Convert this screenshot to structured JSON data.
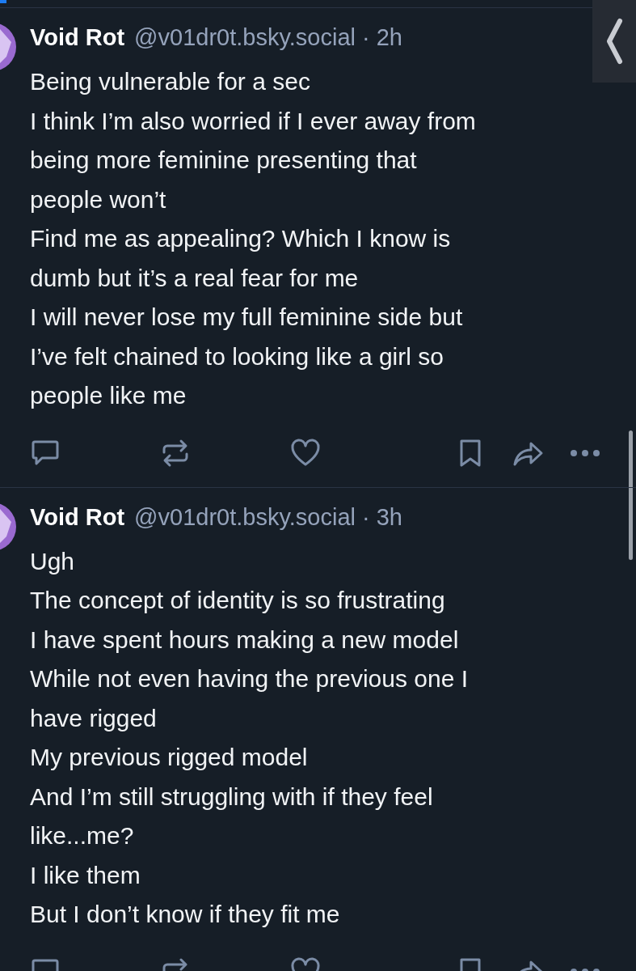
{
  "posts": [
    {
      "name": "Void Rot",
      "handle": "@v01dr0t.bsky.social",
      "separator": "·",
      "time": "2h",
      "text": "Being vulnerable for a sec\nI think I’m also worried if I ever away from\nbeing more feminine presenting that\npeople won’t\nFind me as appealing? Which I know is\ndumb but it’s a real fear for me\nI will never lose my full feminine side but\nI’ve felt chained to looking like a girl so\npeople like me"
    },
    {
      "name": "Void Rot",
      "handle": "@v01dr0t.bsky.social",
      "separator": "·",
      "time": "3h",
      "text": "Ugh\nThe concept of identity is so frustrating\nI have spent hours making a new model\nWhile not even having the previous one I\nhave rigged\nMy previous rigged model\nAnd I’m still struggling with if they feel\nlike...me?\nI like them\nBut I don’t know if they fit me"
    }
  ]
}
